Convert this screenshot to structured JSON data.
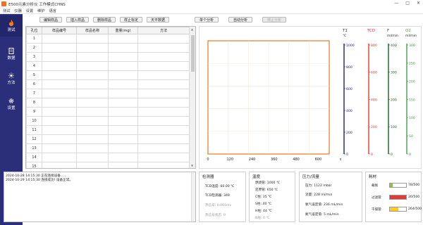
{
  "window": {
    "title": "E500元素分析仪 工作模式CHNS",
    "controls": [
      "—",
      "□",
      "✕"
    ]
  },
  "menu": [
    "测试",
    "仪器",
    "设置",
    "维护",
    "语言"
  ],
  "nav": [
    {
      "label": "测试",
      "icon": "flame-icon"
    },
    {
      "label": "数据",
      "icon": "document-icon"
    },
    {
      "label": "方法",
      "icon": "sun-icon"
    },
    {
      "label": "设置",
      "icon": "gear-icon"
    }
  ],
  "toolbar": {
    "left": [
      "编辑样品",
      "插入样品",
      "删除样品",
      "样止标定",
      "天平数据"
    ],
    "right": [
      "单个分析",
      "自动分析",
      "停止分析"
    ]
  },
  "table": {
    "headers": [
      "孔位",
      "样品编号",
      "样品名称",
      "重量(mg)",
      "方法"
    ],
    "rows": [
      "1",
      "2",
      "3",
      "4",
      "5",
      "6",
      "7",
      "8",
      "9",
      "10",
      "11",
      "12",
      "13",
      "14",
      "15"
    ]
  },
  "chart_data": {
    "type": "line",
    "x_ticks": [
      "0",
      "120",
      "240",
      "360",
      "480",
      "600"
    ],
    "x_unit": "s",
    "xlim": [
      0,
      660
    ],
    "series": [],
    "axes": [
      {
        "name": "T1",
        "unit": "℃",
        "color": "#1a237e",
        "ticks": [
          "1000",
          "800",
          "600",
          "400",
          "200",
          "0"
        ]
      },
      {
        "name": "TCD",
        "unit": "",
        "color": "#e53935",
        "ticks": [
          "800",
          "600",
          "400",
          "200",
          "0"
        ]
      },
      {
        "name": "F",
        "unit": "ml/min",
        "color": "#1b5e20",
        "ticks": [
          "400",
          "300",
          "200",
          "100",
          "0"
        ]
      },
      {
        "name": "O2",
        "unit": "ml/min",
        "color": "#43a047",
        "ticks": [
          "300",
          "250",
          "200",
          "150",
          "100",
          "50",
          "0"
        ]
      }
    ]
  },
  "log": [
    "2024-10-28 14:15:30  正在连接设备......",
    "2024-10-29 14:15:30  连接成功! 设备正常。"
  ],
  "panels": {
    "detector": {
      "title": "检测器",
      "lines": [
        "TCD温度: 60.00 ℃",
        "TCD检测器: 349",
        "热信号: 0.001mv",
        "热信号状态: 0"
      ]
    },
    "temperature": {
      "title": "温度",
      "lines": [
        "燃烧管: 1000 ℃",
        "还原管: 650 ℃",
        "C柱: 35 ℃",
        "S柱: 40 ℃",
        "H柱: 44 ℃",
        "N柱: 0 ℃"
      ]
    },
    "pressure": {
      "title": "压力/流量",
      "lines": [
        "压力: 1122 mbar",
        "流量: 228 ml/min",
        "氧气设定值: 236 mL/min",
        "氮气设定值: 5 mL/min"
      ]
    },
    "consumables": {
      "title": "耗材",
      "items": [
        {
          "label": "载氧",
          "value": "78/500",
          "fraction": 0.16,
          "color": "#8bc34a"
        },
        {
          "label": "过滤管",
          "value": "20/500",
          "fraction": 1.0,
          "color": "#e53935"
        },
        {
          "label": "干燥管",
          "value": "264/500",
          "fraction": 0.53,
          "color": "#ffca28"
        }
      ]
    }
  }
}
